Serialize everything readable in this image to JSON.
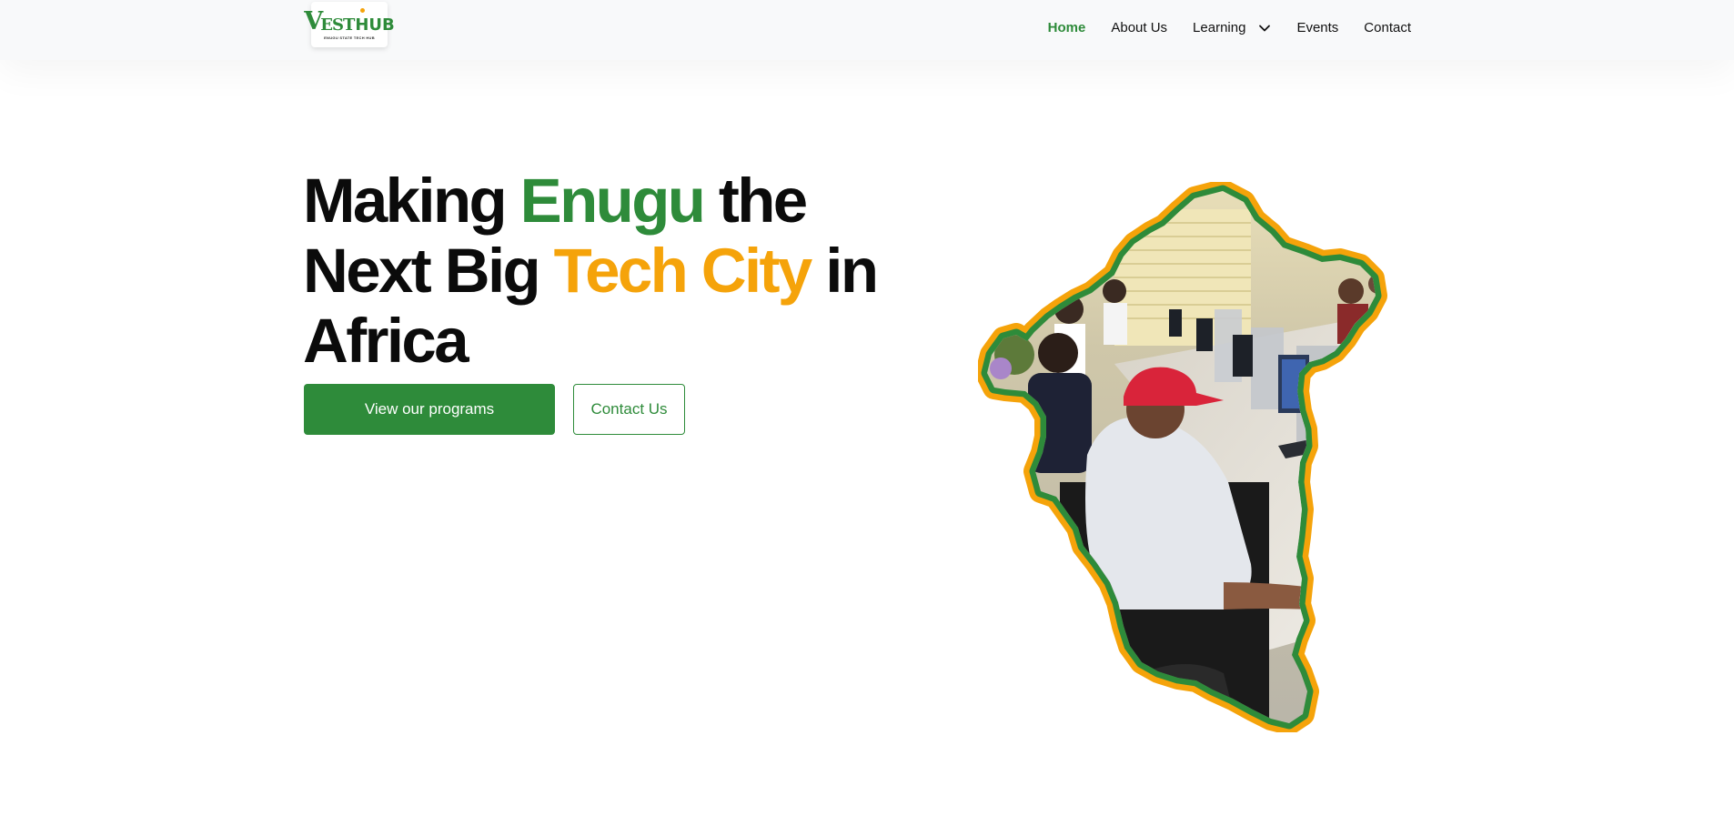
{
  "header": {
    "logo": {
      "mark_v": "V",
      "mark_est": "EST",
      "mark_hub": "HUB",
      "tagline": "ENUGU STATE TECH HUB"
    },
    "nav": {
      "items": [
        {
          "label": "Home",
          "active": true
        },
        {
          "label": "About Us"
        },
        {
          "label": "Learning",
          "has_dropdown": true
        },
        {
          "label": "Events"
        },
        {
          "label": "Contact"
        }
      ]
    }
  },
  "hero": {
    "title_parts": [
      "Making ",
      "Enugu",
      " the Next Big ",
      "Tech City",
      " in Africa"
    ],
    "buttons": {
      "primary": "View our programs",
      "secondary": "Contact Us"
    },
    "image": {
      "icon": "enugu-map-photo",
      "outline_colors": [
        "#2e8b3a",
        "#f5a30a"
      ]
    }
  },
  "colors": {
    "brand_green": "#2e8b3a",
    "brand_orange": "#f5a30a",
    "text": "#0b0b0b",
    "header_bg": "#f8f9fa"
  }
}
